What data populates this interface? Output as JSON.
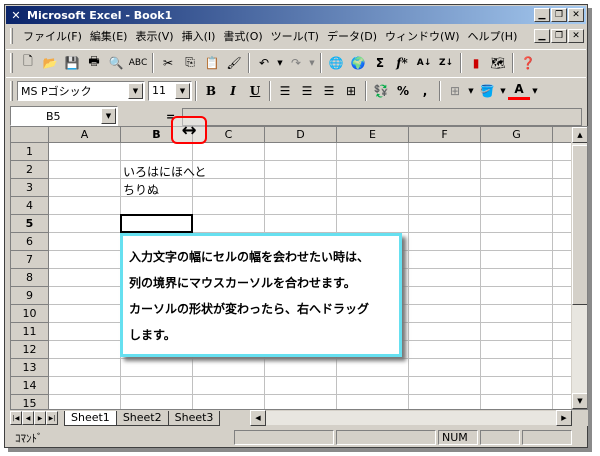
{
  "window": {
    "title": "Microsoft Excel - Book1",
    "app_icon": "excel-x-icon"
  },
  "menu": [
    "ファイル(F)",
    "編集(E)",
    "表示(V)",
    "挿入(I)",
    "書式(O)",
    "ツール(T)",
    "データ(D)",
    "ウィンドウ(W)",
    "ヘルプ(H)"
  ],
  "formatting": {
    "font_name": "MS Pゴシック",
    "font_size": "11",
    "bold": "B",
    "italic": "I",
    "underline": "U",
    "percent": "%",
    "comma": ",",
    "font_color_letter": "A"
  },
  "standard_toolbar": {
    "sigma": "Σ",
    "fx": "f*"
  },
  "formula_bar": {
    "name_box": "B5",
    "equals": "="
  },
  "columns": [
    "A",
    "B",
    "C",
    "D",
    "E",
    "F",
    "G"
  ],
  "rows": [
    "1",
    "2",
    "3",
    "4",
    "5",
    "6",
    "7",
    "8",
    "9",
    "10",
    "11",
    "12",
    "13",
    "14",
    "15"
  ],
  "cells": {
    "B2": "いろはにほへと",
    "B3": "ちりぬ"
  },
  "sheet_tabs": [
    "Sheet1",
    "Sheet2",
    "Sheet3"
  ],
  "status": {
    "mode": "ｺﾏﾝﾄﾞ",
    "num": "NUM"
  },
  "callout": {
    "lines": [
      "入力文字の幅にセルの幅を会わせたい時は、",
      "列の境界にマウスカーソルを合わせます。",
      "カーソルの形状が変わったら、右へドラッグ",
      "します。"
    ]
  },
  "cursor": {
    "icon": "column-resize-cursor-icon",
    "glyph": "↔"
  }
}
